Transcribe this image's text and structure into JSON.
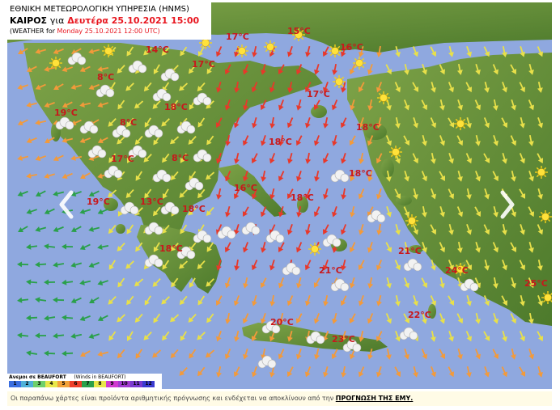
{
  "title": {
    "org": "ΕΘΝΙΚΗ ΜΕΤΕΩΡΟΛΟΓΙΚΗ ΥΠΗΡΕΣΙΑ (HNMS)",
    "weather_prefix": "ΚΑΙΡΟΣ",
    "for_word": "για",
    "date": "Δευτέρα 25.10.2021 15:00",
    "en_prefix": "(WEATHER for",
    "en_date": "Monday 25.10.2021 12:00 UTC)"
  },
  "temperatures": [
    {
      "label": "17°C"
    },
    {
      "label": "15°C"
    },
    {
      "label": "14°C"
    },
    {
      "label": "17°C"
    },
    {
      "label": "16°C"
    },
    {
      "label": "8°C"
    },
    {
      "label": "17°C"
    },
    {
      "label": "19°C"
    },
    {
      "label": "18°C"
    },
    {
      "label": "8°C"
    },
    {
      "label": "18°C"
    },
    {
      "label": "18°C"
    },
    {
      "label": "17°C"
    },
    {
      "label": "8°C"
    },
    {
      "label": "18°C"
    },
    {
      "label": "16°C"
    },
    {
      "label": "18°C"
    },
    {
      "label": "19°C"
    },
    {
      "label": "13°C"
    },
    {
      "label": "18°C"
    },
    {
      "label": "18°C"
    },
    {
      "label": "21°C"
    },
    {
      "label": "21°C"
    },
    {
      "label": "24°C"
    },
    {
      "label": "25°C"
    },
    {
      "label": "22°C"
    },
    {
      "label": "20°C"
    },
    {
      "label": "23°C"
    }
  ],
  "legend": {
    "title": "Ανεμοι σε BEAUFORT",
    "title_en": "(Winds in BEAUFORT)",
    "cells": [
      {
        "label": "1",
        "color": "#3a6ee0"
      },
      {
        "label": "2",
        "color": "#4fb0d8"
      },
      {
        "label": "3",
        "color": "#6fd06a"
      },
      {
        "label": "4",
        "color": "#e8e84a"
      },
      {
        "label": "5",
        "color": "#f3a23a"
      },
      {
        "label": "6",
        "color": "#ef3f2a"
      },
      {
        "label": "7",
        "color": "#2aa04a"
      },
      {
        "label": "8",
        "color": "#e8e84a"
      },
      {
        "label": "9",
        "color": "#d03ad0"
      },
      {
        "label": "10",
        "color": "#a03ad0"
      },
      {
        "label": "11",
        "color": "#7a3ad0"
      },
      {
        "label": "12",
        "color": "#3a3ad0"
      }
    ]
  },
  "footer": {
    "text": "Οι παραπάνω χάρτες είναι προϊόντα αριθμητικής πρόγνωσης και ενδέχεται να αποκλίνουν από την",
    "link": "ΠΡΟΓΝΩΣΗ ΤΗΣ ΕΜΥ."
  },
  "colors": {
    "sea": "#8fa8df",
    "land": "#5a8a34",
    "land_light": "#8db84e",
    "temp_text": "#c8181c",
    "wind_red": "#e8382a",
    "wind_orange": "#f39a3a",
    "wind_yellow": "#e8e04a",
    "wind_green": "#2aa04a"
  },
  "controls": {
    "prev_icon": "chevron-left-icon",
    "next_icon": "chevron-right-icon"
  }
}
